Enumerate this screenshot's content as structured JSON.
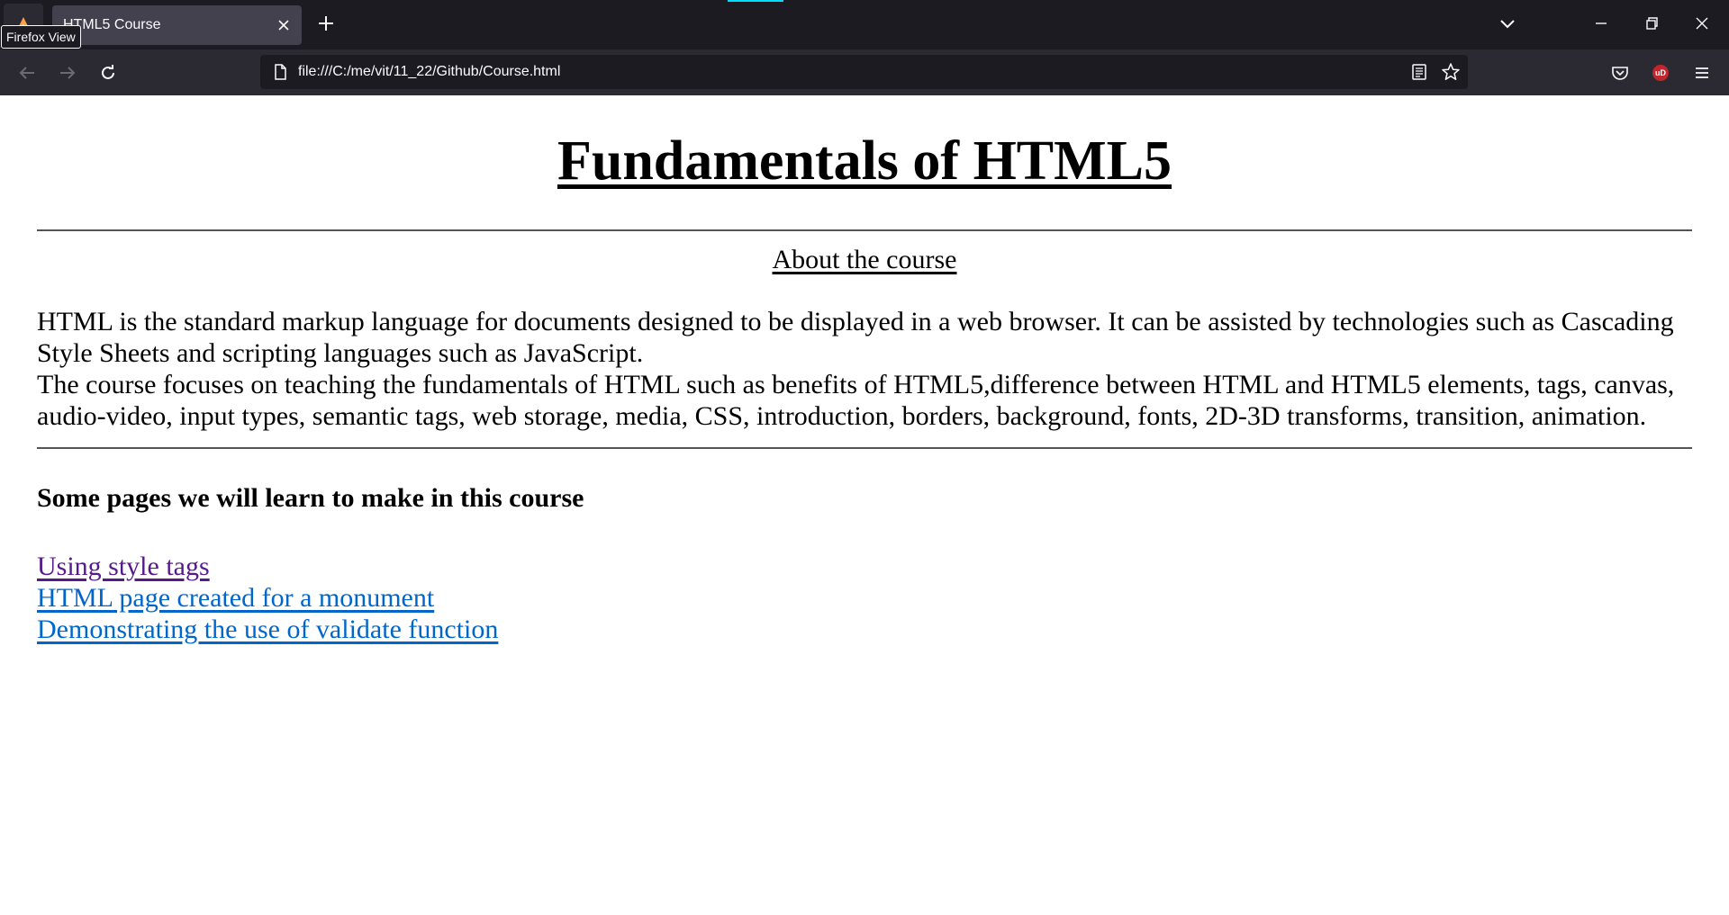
{
  "browser": {
    "tooltip": "Firefox View",
    "tab": {
      "title": "HTML5 Course"
    },
    "url": "file:///C:/me/vit/11_22/Github/Course.html",
    "accent_color": "#00ddff",
    "icons": {
      "firefox_view": "firefox-view-icon",
      "tab_close": "close-icon",
      "new_tab": "plus-icon",
      "tab_list": "chevron-down-icon",
      "minimize": "minimize-icon",
      "restore": "restore-icon",
      "close_window": "close-icon",
      "back": "arrow-left-icon",
      "forward": "arrow-right-icon",
      "reload": "reload-icon",
      "page_info": "page-icon",
      "reader": "reader-mode-icon",
      "bookmark": "star-icon",
      "pocket": "pocket-icon",
      "ublock": "ublock-origin-icon",
      "menu": "hamburger-menu-icon"
    },
    "ublock_badge_text": "uD"
  },
  "page": {
    "title": "Fundamentals of HTML5",
    "about_heading": "About the course",
    "paragraph_line1": "HTML is the standard markup language for documents designed to be displayed in a web browser. It can be assisted by technologies such as Cascading Style Sheets and scripting languages such as JavaScript.",
    "paragraph_line2": "The course focuses on teaching the fundamentals of HTML such as benefits of HTML5,difference between HTML and HTML5 elements, tags, canvas, audio-video, input types, semantic tags, web storage, media, CSS, introduction, borders, background, fonts, 2D-3D transforms, transition, animation.",
    "section_heading": "Some pages we will learn to make in this course",
    "links": [
      {
        "label": "Using style tags",
        "visited": true,
        "color": "#551a8b"
      },
      {
        "label": "HTML page created for a monument",
        "visited": false,
        "color": "#0066cc"
      },
      {
        "label": "Demonstrating the use of validate function",
        "visited": false,
        "color": "#0066cc"
      }
    ]
  }
}
